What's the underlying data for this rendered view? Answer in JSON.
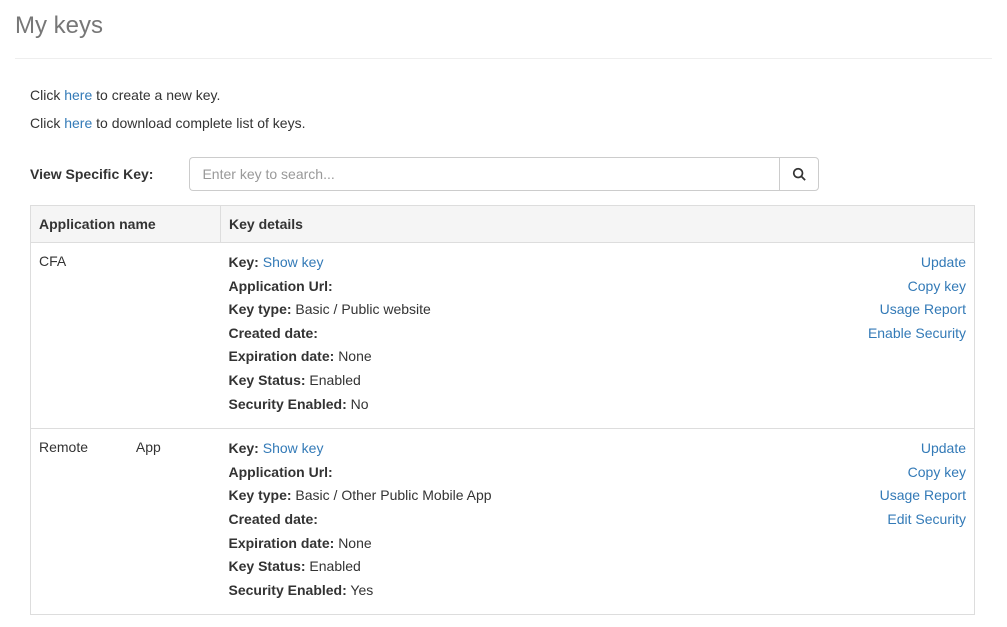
{
  "page_title": "My keys",
  "intro": {
    "prefix": "Click ",
    "here": "here",
    "create_suffix": " to create a new key.",
    "download_suffix": " to download complete list of keys."
  },
  "search": {
    "label": "View Specific Key:",
    "placeholder": "Enter key to search..."
  },
  "table": {
    "headers": {
      "app": "Application name",
      "details": "Key details"
    }
  },
  "labels": {
    "key": "Key:",
    "app_url": "Application Url:",
    "key_type": "Key type:",
    "created": "Created date:",
    "expiration": "Expiration date:",
    "status": "Key Status:",
    "security": "Security Enabled:",
    "show_key": "Show key"
  },
  "rows": [
    {
      "app_name": {
        "part1": "CFA",
        "part2": ""
      },
      "app_url": "",
      "key_type": "Basic / Public website",
      "created": "",
      "expiration": "None",
      "status": "Enabled",
      "security": "No",
      "actions": [
        "Update",
        "Copy key",
        "Usage Report",
        "Enable Security"
      ]
    },
    {
      "app_name": {
        "part1": "Remote",
        "part2": "App"
      },
      "app_url": "",
      "key_type": "Basic / Other Public Mobile App",
      "created": "",
      "expiration": "None",
      "status": "Enabled",
      "security": "Yes",
      "actions": [
        "Update",
        "Copy key",
        "Usage Report",
        "Edit Security"
      ]
    }
  ]
}
